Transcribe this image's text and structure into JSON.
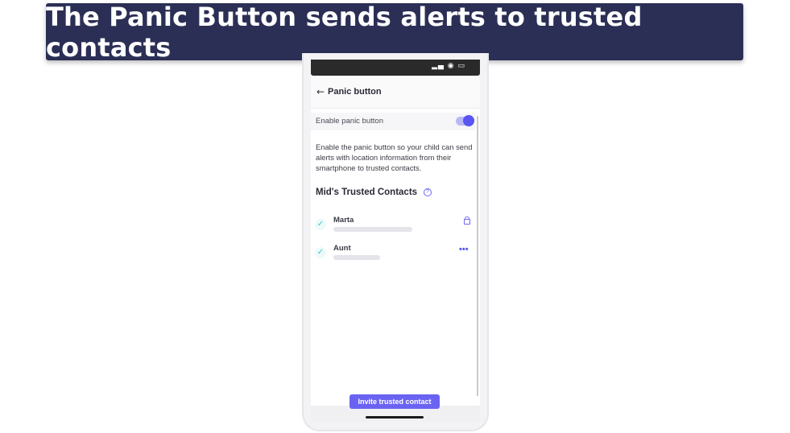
{
  "banner": {
    "title": "The Panic Button sends alerts to trusted contacts"
  },
  "screen": {
    "title": "Panic button",
    "toggle": {
      "label": "Enable panic button",
      "enabled": true
    },
    "description": "Enable the panic button so your child can send alerts with location information from their smartphone to trusted contacts.",
    "section_title": "Mid's Trusted Contacts",
    "contacts": [
      {
        "name": "Marta",
        "checked": true,
        "action_icon": "lock-icon"
      },
      {
        "name": "Aunt",
        "checked": true,
        "action_icon": "more-icon"
      }
    ],
    "invite_label": "Invite trusted contact"
  },
  "colors": {
    "banner_bg": "#2b2f55",
    "accent": "#5a55f0",
    "check": "#3cc7c9"
  }
}
